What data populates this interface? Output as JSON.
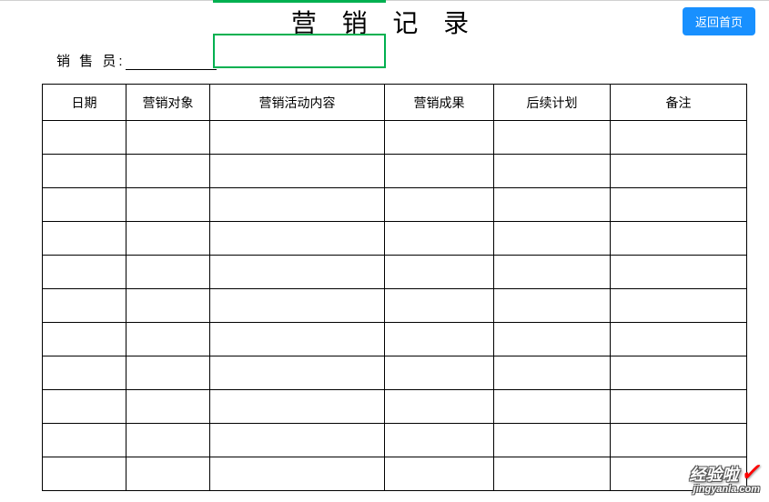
{
  "title": "营 销 记 录",
  "return_button_label": "返回首页",
  "salesperson_label": "销 售 员:",
  "salesperson_value": "",
  "table": {
    "headers": [
      "日期",
      "营销对象",
      "营销活动内容",
      "营销成果",
      "后续计划",
      "备注"
    ],
    "rows": [
      [
        "",
        "",
        "",
        "",
        "",
        ""
      ],
      [
        "",
        "",
        "",
        "",
        "",
        ""
      ],
      [
        "",
        "",
        "",
        "",
        "",
        ""
      ],
      [
        "",
        "",
        "",
        "",
        "",
        ""
      ],
      [
        "",
        "",
        "",
        "",
        "",
        ""
      ],
      [
        "",
        "",
        "",
        "",
        "",
        ""
      ],
      [
        "",
        "",
        "",
        "",
        "",
        ""
      ],
      [
        "",
        "",
        "",
        "",
        "",
        ""
      ],
      [
        "",
        "",
        "",
        "",
        "",
        ""
      ],
      [
        "",
        "",
        "",
        "",
        "",
        ""
      ],
      [
        "",
        "",
        "",
        "",
        "",
        ""
      ]
    ]
  },
  "watermark": {
    "main": "经验啦",
    "sub": "jingyanla.com"
  }
}
